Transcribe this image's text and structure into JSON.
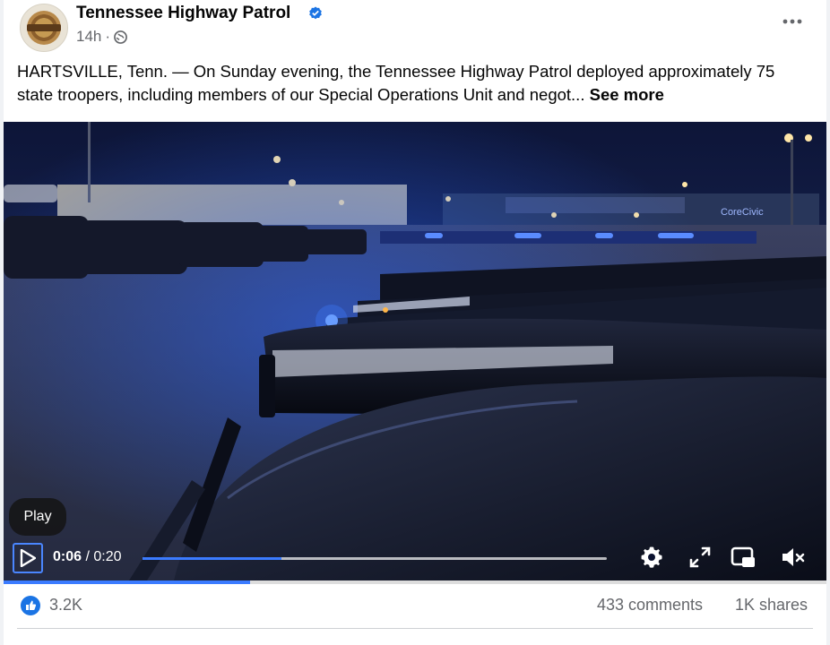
{
  "post": {
    "page_name": "Tennessee Highway Patrol",
    "time_ago": "14h",
    "separator": "·",
    "text": "HARTSVILLE, Tenn. — On Sunday evening, the Tennessee Highway Patrol deployed approximately 75 state troopers, including members of our Special Operations Unit and negot...",
    "see_more": "See more"
  },
  "video": {
    "tooltip": "Play",
    "current_time": "0:06",
    "time_separator": " / ",
    "duration": "0:20",
    "progress_fraction": 0.3,
    "sign_text": "CoreCivic"
  },
  "stats": {
    "reactions": "3.2K",
    "comments": "433 comments",
    "shares": "1K shares"
  },
  "colors": {
    "accent": "#1b74e4",
    "progress": "#3b7bff",
    "muted_text": "#65676b"
  },
  "icons": [
    "verified-badge-icon",
    "globe-icon",
    "more-options-icon",
    "play-icon",
    "settings-icon",
    "fullscreen-icon",
    "picture-in-picture-icon",
    "mute-icon",
    "like-icon"
  ]
}
